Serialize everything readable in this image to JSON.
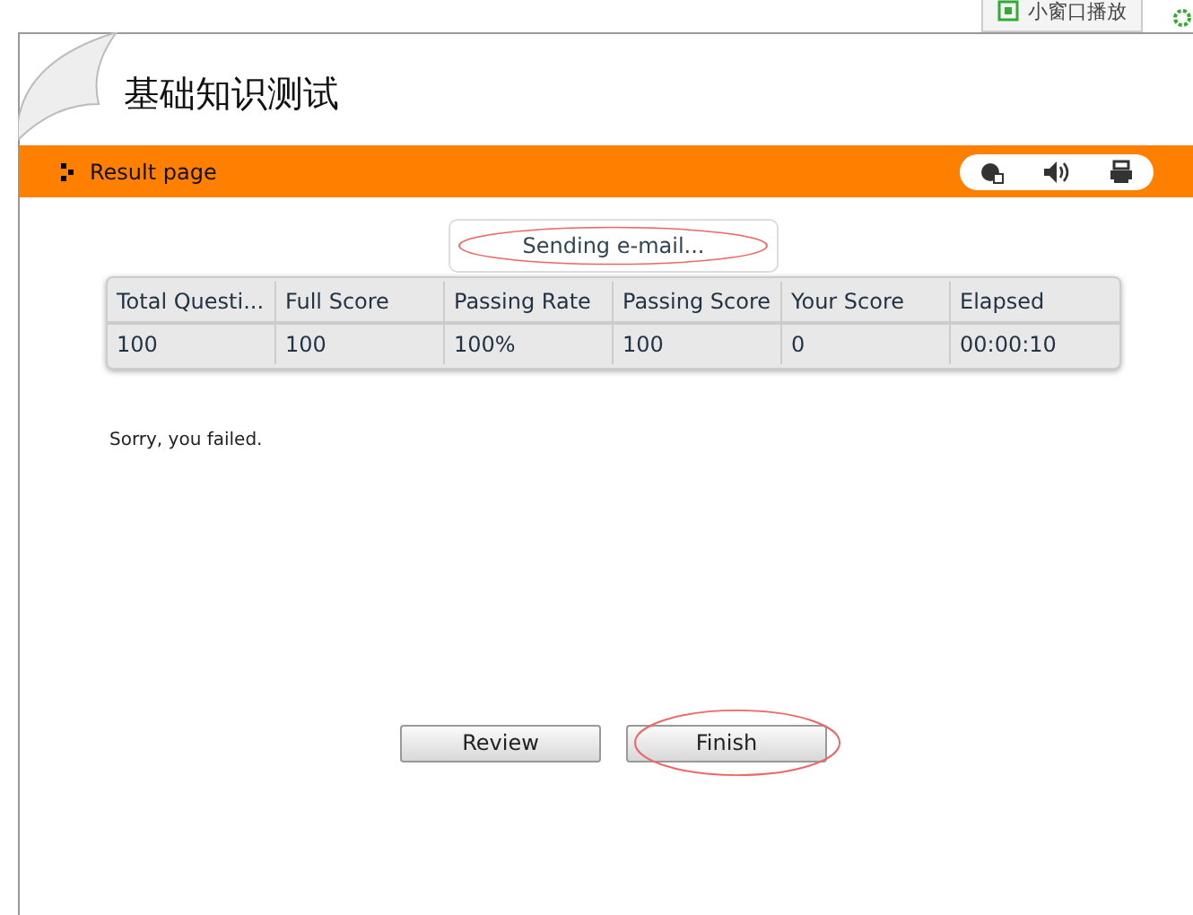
{
  "corner_tab": {
    "label": "小窗口播放"
  },
  "title": "基础知识测试",
  "bar": {
    "label": "Result page"
  },
  "status": "Sending e-mail...",
  "table": {
    "columns": [
      "Total Questi...",
      "Full Score",
      "Passing Rate",
      "Passing Score",
      "Your Score",
      "Elapsed"
    ],
    "rows": [
      [
        "100",
        "100",
        "100%",
        "100",
        "0",
        "00:00:10"
      ]
    ]
  },
  "message": "Sorry, you failed.",
  "buttons": [
    {
      "label": "Review",
      "highlighted": false
    },
    {
      "label": "Finish",
      "highlighted": true
    }
  ]
}
